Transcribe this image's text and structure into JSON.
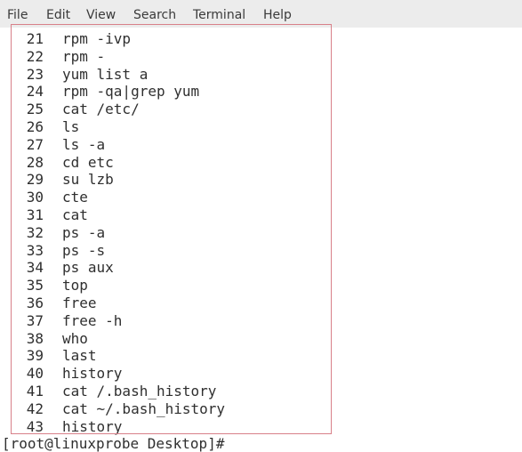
{
  "menubar": {
    "items": [
      {
        "label": "File"
      },
      {
        "label": "Edit"
      },
      {
        "label": "View"
      },
      {
        "label": "Search"
      },
      {
        "label": "Terminal"
      },
      {
        "label": "Help"
      }
    ]
  },
  "terminal": {
    "history": [
      {
        "num": "21",
        "cmd": "rpm -ivp"
      },
      {
        "num": "22",
        "cmd": "rpm -"
      },
      {
        "num": "23",
        "cmd": "yum list a"
      },
      {
        "num": "24",
        "cmd": "rpm -qa|grep yum"
      },
      {
        "num": "25",
        "cmd": "cat /etc/"
      },
      {
        "num": "26",
        "cmd": "ls"
      },
      {
        "num": "27",
        "cmd": "ls -a"
      },
      {
        "num": "28",
        "cmd": "cd etc"
      },
      {
        "num": "29",
        "cmd": "su lzb"
      },
      {
        "num": "30",
        "cmd": "cte"
      },
      {
        "num": "31",
        "cmd": "cat"
      },
      {
        "num": "32",
        "cmd": "ps -a"
      },
      {
        "num": "33",
        "cmd": "ps -s"
      },
      {
        "num": "34",
        "cmd": "ps aux"
      },
      {
        "num": "35",
        "cmd": "top"
      },
      {
        "num": "36",
        "cmd": "free"
      },
      {
        "num": "37",
        "cmd": "free -h"
      },
      {
        "num": "38",
        "cmd": "who"
      },
      {
        "num": "39",
        "cmd": "last"
      },
      {
        "num": "40",
        "cmd": "history"
      },
      {
        "num": "41",
        "cmd": "cat /.bash_history"
      },
      {
        "num": "42",
        "cmd": "cat ~/.bash_history"
      },
      {
        "num": "43",
        "cmd": "history"
      }
    ],
    "prompt": "[root@linuxprobe Desktop]#"
  },
  "annotation": {
    "box_color": "#d88089"
  }
}
